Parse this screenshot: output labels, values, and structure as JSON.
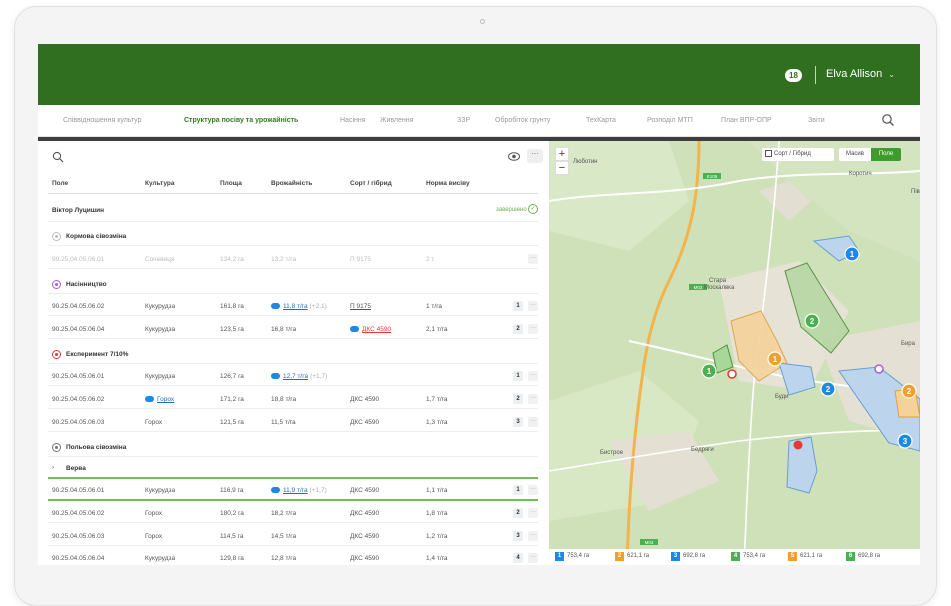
{
  "header": {
    "notifications": "18",
    "user_name": "Elva Allison"
  },
  "tabs": [
    {
      "label": "Співвідношення культур",
      "active": false
    },
    {
      "label": "Структура посіву та урожайність",
      "active": true
    },
    {
      "label": "Насіння",
      "active": false
    },
    {
      "label": "Живлення",
      "active": false
    },
    {
      "label": "ЗЗР",
      "active": false
    },
    {
      "label": "Обробіток грунту",
      "active": false
    },
    {
      "label": "ТехКарта",
      "active": false
    },
    {
      "label": "Розподіл МТП",
      "active": false
    },
    {
      "label": "План ВПР-ОПР",
      "active": false
    },
    {
      "label": "Звіти",
      "active": false
    }
  ],
  "table": {
    "more_label": "···",
    "columns": [
      "Поле",
      "Культура",
      "Площа",
      "Врожайність",
      "Сорт / гібрид",
      "Норма висіву"
    ],
    "owner": "Віктор Луцишин",
    "status": "завершено",
    "groups": [
      {
        "name": "Кормова сівозміна",
        "color": "#bdbdbd",
        "rows": [
          {
            "field": "90.25.04.05.06.01",
            "crop": "Сочевиця",
            "area": "134,2 га",
            "yield": "13,2 т/га",
            "variety": "П 9175",
            "rate": "2 т",
            "num": "",
            "more": "···"
          }
        ]
      },
      {
        "name": "Насінництво",
        "color": "#a55fd6",
        "rows": [
          {
            "field": "90.25.04.05.06.02",
            "crop": "Кукурудза",
            "area": "161,8 га",
            "yield": "11,8 т/га",
            "yield_extra": "(+2,1)",
            "variety": "П 9175",
            "rate": "1 т/га",
            "num": "1",
            "more": "···"
          },
          {
            "field": "90.25.04.05.06.04",
            "crop": "Кукурудза",
            "area": "123,5 га",
            "yield": "16,8 т/га",
            "variety": "ДКС 4590",
            "rate": "2,1 т/га",
            "num": "2",
            "more": "···"
          }
        ]
      },
      {
        "name": "Експеримент 7/10%",
        "color": "#e53935",
        "rows": [
          {
            "field": "90.25.04.05.06.01",
            "crop": "Кукурудза",
            "area": "126,7 га",
            "yield": "12,7 т/га",
            "yield_extra": "(+1,7)",
            "variety": "",
            "rate": "",
            "num": "1",
            "more": "···"
          },
          {
            "field": "90.25.04.05.06.02",
            "crop": "Горох",
            "area": "171,2 га",
            "yield": "18,8 т/га",
            "variety": "ДКС 4590",
            "rate": "1,7 т/га",
            "num": "2",
            "more": "···"
          },
          {
            "field": "90.25.04.05.06.03",
            "crop": "Горох",
            "area": "121,5 га",
            "yield": "11,5 т/га",
            "variety": "ДКС 4590",
            "rate": "1,3 т/га",
            "num": "3",
            "more": "···"
          }
        ]
      },
      {
        "name": "Польова сівозміна",
        "color": "#757575",
        "subgroup": "Верва",
        "rows": [
          {
            "field": "90.25.04.05.06.01",
            "crop": "Кукурудза",
            "area": "116,9 га",
            "yield": "11,9 т/га",
            "yield_extra": "(+1,7)",
            "variety": "ДКС 4590",
            "rate": "1,1 т/га",
            "num": "1",
            "more": "···"
          },
          {
            "field": "90.25.04.05.06.02",
            "crop": "Горох",
            "area": "180,2 га",
            "yield": "18,2 т/га",
            "variety": "ДКС 4590",
            "rate": "1,8 т/га",
            "num": "2",
            "more": "···"
          },
          {
            "field": "90.25.04.05.06.03",
            "crop": "Горох",
            "area": "114,5 га",
            "yield": "14,5 т/га",
            "variety": "ДКС 4590",
            "rate": "1,2 т/га",
            "num": "3",
            "more": "···"
          },
          {
            "field": "90.25.04.05.06.04",
            "crop": "Кукурудза",
            "area": "129,8 га",
            "yield": "12,8 т/га",
            "variety": "ДКС 4590",
            "rate": "1,4 т/га",
            "num": "4",
            "more": "···"
          }
        ]
      }
    ]
  },
  "map": {
    "zoom_in": "+",
    "zoom_out": "−",
    "sort_hybrid": "Сорт / Гібрид",
    "massif": "Масив",
    "field": "Поле",
    "places": [
      "Люботин",
      "Коротич",
      "Стара",
      "Москалвка",
      "Пів",
      "Бира",
      "Буди",
      "Бистрое",
      "Бедряги"
    ],
    "roads": [
      "Е105",
      "М03"
    ],
    "markers": [
      "1",
      "2",
      "1",
      "2",
      "3",
      "1",
      "2"
    ],
    "legend": [
      {
        "num": "1",
        "color": "#1e88e5",
        "value": "753,4 га"
      },
      {
        "num": "2",
        "color": "#f0a030",
        "value": "621,1 га"
      },
      {
        "num": "3",
        "color": "#1e88e5",
        "value": "692,8 га"
      },
      {
        "num": "4",
        "color": "#4caf50",
        "value": "753,4 га"
      },
      {
        "num": "5",
        "color": "#f0a030",
        "value": "621,1 га"
      },
      {
        "num": "6",
        "color": "#4caf50",
        "value": "692,8 га"
      }
    ]
  }
}
